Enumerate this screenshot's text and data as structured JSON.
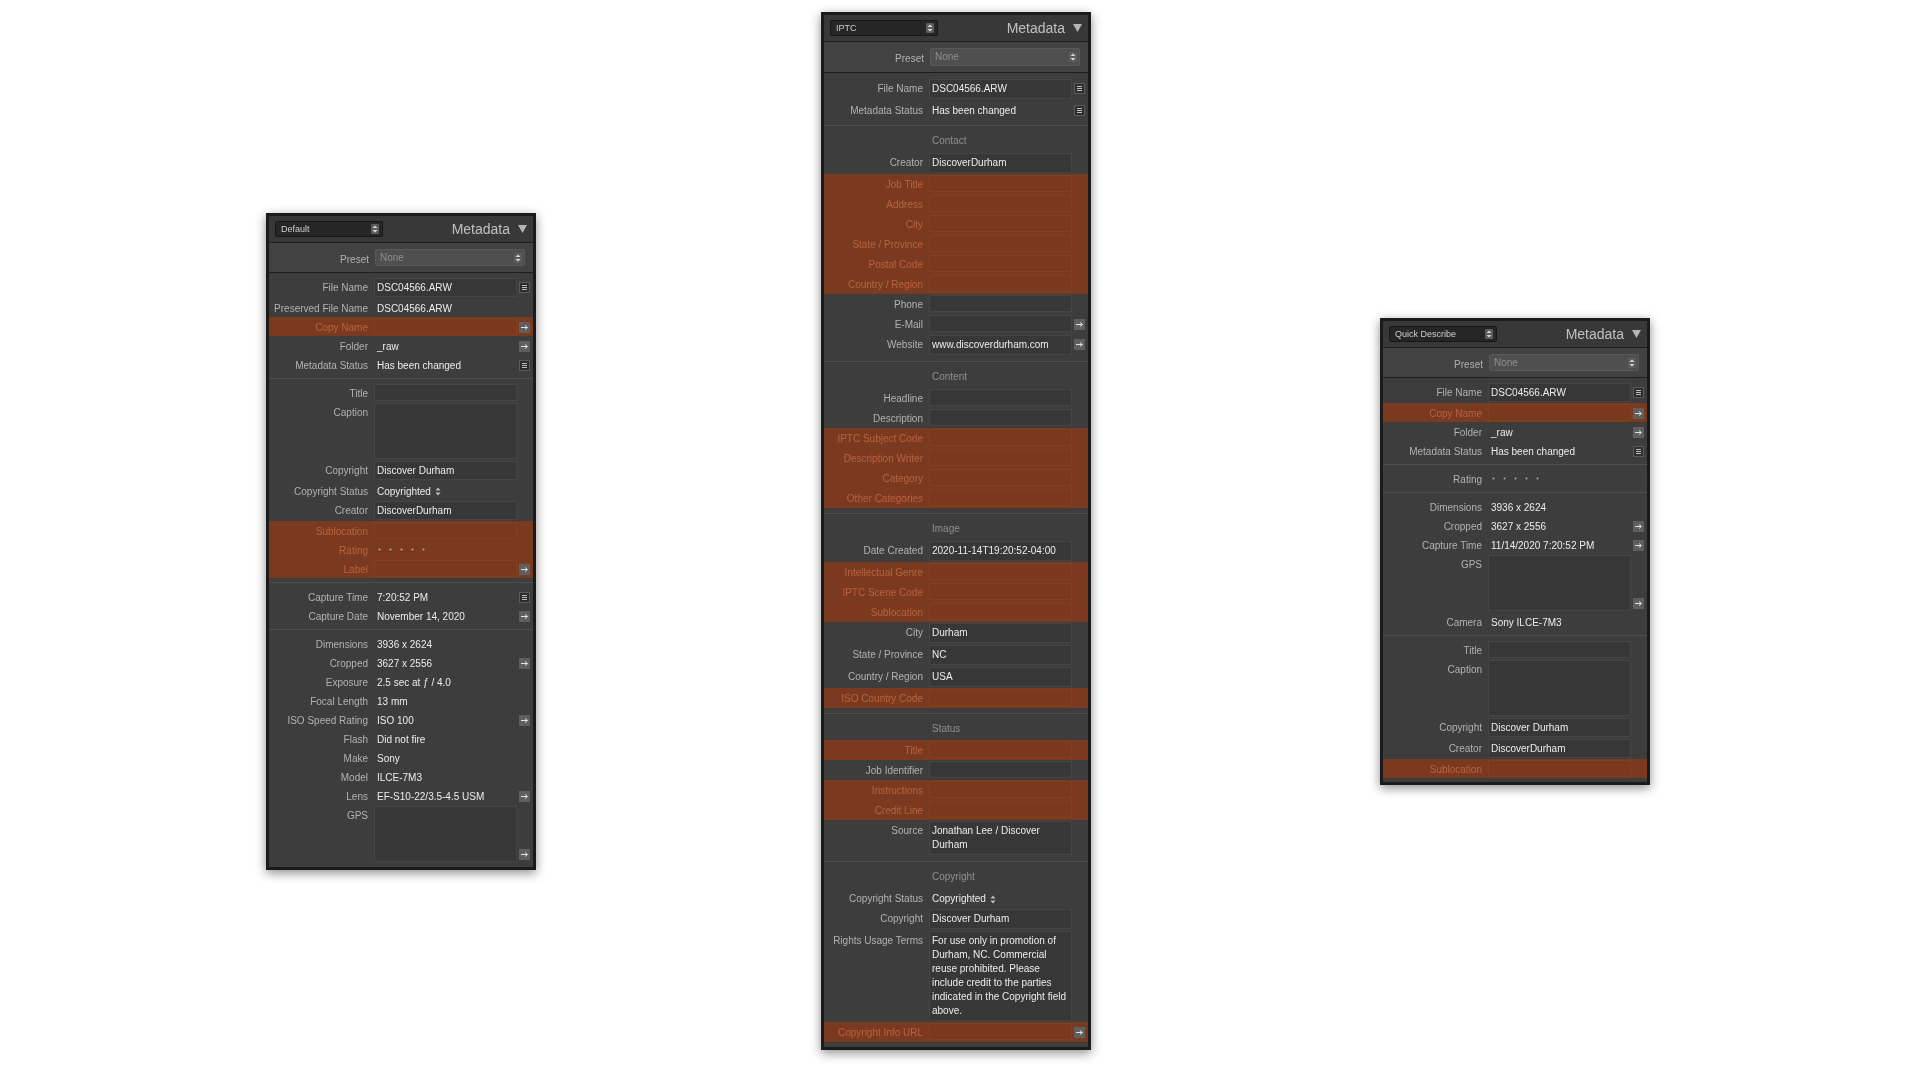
{
  "panels": [
    {
      "preset_menu": "Default",
      "title": "Metadata",
      "preset": {
        "label": "Preset",
        "value": "None"
      },
      "sections": [
        {
          "rows": [
            {
              "label": "File Name",
              "kind": "field",
              "value": "DSC04566.ARW",
              "highlighted": false,
              "list_button": true
            },
            {
              "label": "Preserved File Name",
              "kind": "text",
              "value": "DSC04566.ARW",
              "highlighted": false
            },
            {
              "label": "Copy Name",
              "kind": "field",
              "highlighted": true,
              "arrow_button": true
            },
            {
              "label": "Folder",
              "kind": "text",
              "value": "_raw",
              "highlighted": false,
              "arrow_button": true
            },
            {
              "label": "Metadata Status",
              "kind": "text",
              "value": "Has been changed",
              "highlighted": false,
              "list_button": true
            }
          ]
        },
        {
          "rows": [
            {
              "label": "Title",
              "kind": "field",
              "highlighted": false
            },
            {
              "label": "Caption",
              "kind": "area",
              "highlighted": false
            },
            {
              "label": "Copyright",
              "kind": "field",
              "value": "Discover Durham",
              "highlighted": false
            },
            {
              "label": "Copyright Status",
              "kind": "select",
              "value": "Copyrighted",
              "highlighted": false
            },
            {
              "label": "Creator",
              "kind": "field",
              "value": "DiscoverDurham",
              "highlighted": false
            },
            {
              "label": "Sublocation",
              "kind": "field",
              "highlighted": true
            },
            {
              "label": "Rating",
              "kind": "rating",
              "highlighted": true
            },
            {
              "label": "Label",
              "kind": "field",
              "highlighted": true,
              "arrow_button": true
            }
          ]
        },
        {
          "rows": [
            {
              "label": "Capture Time",
              "kind": "text",
              "value": "7:20:52 PM",
              "highlighted": false,
              "list_button": true
            },
            {
              "label": "Capture Date",
              "kind": "text",
              "value": "November 14, 2020",
              "highlighted": false,
              "arrow_button": true
            }
          ]
        },
        {
          "rows": [
            {
              "label": "Dimensions",
              "kind": "text",
              "value": "3936 x 2624",
              "highlighted": false
            },
            {
              "label": "Cropped",
              "kind": "text",
              "value": "3627 x 2556",
              "highlighted": false,
              "arrow_button": true
            },
            {
              "label": "Exposure",
              "kind": "text",
              "value": "2.5 sec at ƒ / 4.0",
              "highlighted": false
            },
            {
              "label": "Focal Length",
              "kind": "text",
              "value": "13 mm",
              "highlighted": false
            },
            {
              "label": "ISO Speed Rating",
              "kind": "text",
              "value": "ISO 100",
              "highlighted": false,
              "arrow_button": true
            },
            {
              "label": "Flash",
              "kind": "text",
              "value": "Did not fire",
              "highlighted": false
            },
            {
              "label": "Make",
              "kind": "text",
              "value": "Sony",
              "highlighted": false
            },
            {
              "label": "Model",
              "kind": "text",
              "value": "ILCE-7M3",
              "highlighted": false
            },
            {
              "label": "Lens",
              "kind": "text",
              "value": "EF-S10-22/3.5-4.5 USM",
              "highlighted": false,
              "arrow_button": true
            },
            {
              "label": "GPS",
              "kind": "area",
              "highlighted": false,
              "arrow_button": true
            }
          ]
        }
      ]
    },
    {
      "preset_menu": "IPTC",
      "title": "Metadata",
      "preset": {
        "label": "Preset",
        "value": "None"
      },
      "sections": [
        {
          "rows": [
            {
              "label": "File Name",
              "kind": "field",
              "value": "DSC04566.ARW",
              "highlighted": false,
              "list_button": true
            },
            {
              "label": "Metadata Status",
              "kind": "text",
              "value": "Has been changed",
              "highlighted": false,
              "list_button": true
            }
          ]
        },
        {
          "heading": "Contact",
          "rows": [
            {
              "label": "Creator",
              "kind": "field",
              "value": "DiscoverDurham",
              "highlighted": false
            },
            {
              "label": "Job Title",
              "kind": "field",
              "highlighted": true
            },
            {
              "label": "Address",
              "kind": "field",
              "highlighted": true
            },
            {
              "label": "City",
              "kind": "field",
              "highlighted": true
            },
            {
              "label": "State / Province",
              "kind": "field",
              "highlighted": true
            },
            {
              "label": "Postal Code",
              "kind": "field",
              "highlighted": true
            },
            {
              "label": "Country / Region",
              "kind": "field",
              "highlighted": true
            },
            {
              "label": "Phone",
              "kind": "field",
              "highlighted": false
            },
            {
              "label": "E-Mail",
              "kind": "field",
              "highlighted": false,
              "arrow_button": true
            },
            {
              "label": "Website",
              "kind": "field",
              "value": "www.discoverdurham.com",
              "highlighted": false,
              "arrow_button": true
            }
          ]
        },
        {
          "heading": "Content",
          "rows": [
            {
              "label": "Headline",
              "kind": "field",
              "highlighted": false
            },
            {
              "label": "Description",
              "kind": "field",
              "highlighted": false
            },
            {
              "label": "IPTC Subject Code",
              "kind": "field",
              "highlighted": true
            },
            {
              "label": "Description Writer",
              "kind": "field",
              "highlighted": true
            },
            {
              "label": "Category",
              "kind": "field",
              "highlighted": true
            },
            {
              "label": "Other Categories",
              "kind": "field",
              "highlighted": true
            }
          ]
        },
        {
          "heading": "Image",
          "rows": [
            {
              "label": "Date Created",
              "kind": "field",
              "value": "2020-11-14T19:20:52-04:00",
              "highlighted": false
            },
            {
              "label": "Intellectual Genre",
              "kind": "field",
              "highlighted": true
            },
            {
              "label": "IPTC Scene Code",
              "kind": "field",
              "highlighted": true
            },
            {
              "label": "Sublocation",
              "kind": "field",
              "highlighted": true
            },
            {
              "label": "City",
              "kind": "field",
              "value": "Durham",
              "highlighted": false
            },
            {
              "label": "State / Province",
              "kind": "field",
              "value": "NC",
              "highlighted": false
            },
            {
              "label": "Country / Region",
              "kind": "field",
              "value": "USA",
              "highlighted": false
            },
            {
              "label": "ISO Country Code",
              "kind": "field",
              "highlighted": true
            }
          ]
        },
        {
          "heading": "Status",
          "rows": [
            {
              "label": "Title",
              "kind": "field",
              "highlighted": true
            },
            {
              "label": "Job Identifier",
              "kind": "field",
              "highlighted": false
            },
            {
              "label": "Instructions",
              "kind": "field",
              "highlighted": true
            },
            {
              "label": "Credit Line",
              "kind": "field",
              "highlighted": true
            },
            {
              "label": "Source",
              "kind": "field",
              "value": "Jonathan Lee / Discover Durham",
              "highlighted": false
            }
          ]
        },
        {
          "heading": "Copyright",
          "rows": [
            {
              "label": "Copyright Status",
              "kind": "select",
              "value": "Copyrighted",
              "highlighted": false
            },
            {
              "label": "Copyright",
              "kind": "field",
              "value": "Discover Durham",
              "highlighted": false
            },
            {
              "label": "Rights Usage Terms",
              "kind": "field",
              "value": "For use only in promotion of Durham, NC. Commercial reuse prohibited. Please include credit to the parties indicated in the Copyright field above.",
              "highlighted": false
            },
            {
              "label": "Copyright Info URL",
              "kind": "field",
              "highlighted": true,
              "arrow_button": true
            }
          ]
        }
      ]
    },
    {
      "preset_menu": "Quick Describe",
      "title": "Metadata",
      "preset": {
        "label": "Preset",
        "value": "None"
      },
      "sections": [
        {
          "rows": [
            {
              "label": "File Name",
              "kind": "field",
              "value": "DSC04566.ARW",
              "highlighted": false,
              "list_button": true
            },
            {
              "label": "Copy Name",
              "kind": "field",
              "highlighted": true,
              "arrow_button": true
            },
            {
              "label": "Folder",
              "kind": "text",
              "value": "_raw",
              "highlighted": false,
              "arrow_button": true
            },
            {
              "label": "Metadata Status",
              "kind": "text",
              "value": "Has been changed",
              "highlighted": false,
              "list_button": true
            }
          ]
        },
        {
          "rows": [
            {
              "label": "Rating",
              "kind": "rating",
              "highlighted": false
            }
          ]
        },
        {
          "rows": [
            {
              "label": "Dimensions",
              "kind": "text",
              "value": "3936 x 2624",
              "highlighted": false
            },
            {
              "label": "Cropped",
              "kind": "text",
              "value": "3627 x 2556",
              "highlighted": false,
              "arrow_button": true
            },
            {
              "label": "Capture Time",
              "kind": "text",
              "value": "11/14/2020 7:20:52 PM",
              "highlighted": false,
              "arrow_button": true
            },
            {
              "label": "GPS",
              "kind": "area",
              "highlighted": false,
              "arrow_button": true
            },
            {
              "label": "Camera",
              "kind": "text",
              "value": "Sony ILCE-7M3",
              "highlighted": false
            }
          ]
        },
        {
          "rows": [
            {
              "label": "Title",
              "kind": "field",
              "highlighted": false
            },
            {
              "label": "Caption",
              "kind": "area",
              "highlighted": false
            },
            {
              "label": "Copyright",
              "kind": "field",
              "value": "Discover Durham",
              "highlighted": false
            },
            {
              "label": "Creator",
              "kind": "field",
              "value": "DiscoverDurham",
              "highlighted": false
            },
            {
              "label": "Sublocation",
              "kind": "field",
              "highlighted": true
            }
          ]
        }
      ]
    }
  ]
}
